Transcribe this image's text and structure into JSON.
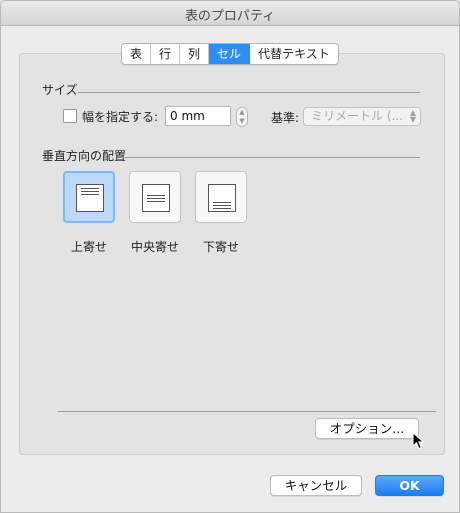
{
  "window": {
    "title": "表のプロパティ"
  },
  "tabs": [
    {
      "label": "表"
    },
    {
      "label": "行"
    },
    {
      "label": "列"
    },
    {
      "label": "セル",
      "active": true
    },
    {
      "label": "代替テキスト"
    }
  ],
  "size_section": {
    "title": "サイズ",
    "width_checkbox_label": "幅を指定する:",
    "width_checked": false,
    "width_value": "0 mm",
    "basis_label": "基準:",
    "basis_selected": "ミリメートル (..."
  },
  "vertical_section": {
    "title": "垂直方向の配置",
    "options": [
      {
        "label": "上寄せ",
        "selected": true
      },
      {
        "label": "中央寄せ",
        "selected": false
      },
      {
        "label": "下寄せ",
        "selected": false
      }
    ]
  },
  "buttons": {
    "options": "オプション...",
    "cancel": "キャンセル",
    "ok": "OK"
  },
  "colors": {
    "accent": "#2f8ef6",
    "selected_bg": "#bcd9fb"
  }
}
